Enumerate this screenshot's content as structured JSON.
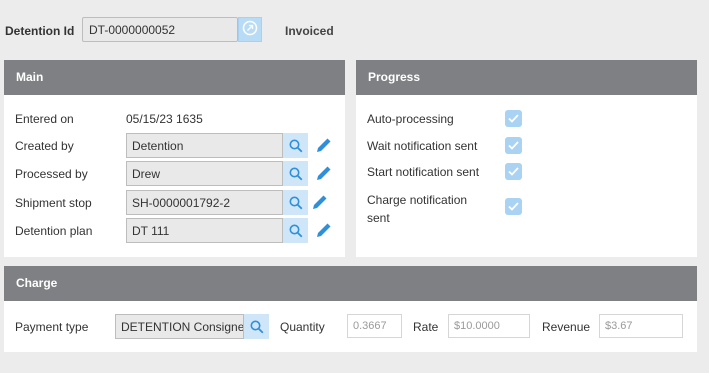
{
  "header": {
    "id_label": "Detention Id",
    "id_value": "DT-0000000052",
    "status": "Invoiced"
  },
  "main": {
    "title": "Main",
    "entered_on_label": "Entered on",
    "entered_on_value": "05/15/23 1635",
    "created_by_label": "Created by",
    "created_by_value": "Detention",
    "processed_by_label": "Processed by",
    "processed_by_value": "Drew",
    "shipment_stop_label": "Shipment stop",
    "shipment_stop_value": "SH-0000001792-2",
    "detention_plan_label": "Detention plan",
    "detention_plan_value": "DT 111"
  },
  "progress": {
    "title": "Progress",
    "items": [
      {
        "label": "Auto-processing",
        "checked": true
      },
      {
        "label": "Wait notification sent",
        "checked": true
      },
      {
        "label": "Start notification sent",
        "checked": true
      },
      {
        "label_line1": "Charge notification",
        "label_line2": "sent",
        "checked": true
      }
    ]
  },
  "charge": {
    "title": "Charge",
    "payment_type_label": "Payment type",
    "payment_type_value": "DETENTION Consignee",
    "quantity_label": "Quantity",
    "quantity_value": "0.3667",
    "rate_label": "Rate",
    "rate_value": "$10.0000",
    "revenue_label": "Revenue",
    "revenue_value": "$3.67"
  },
  "icons": {
    "search": "search-icon",
    "edit": "pencil-icon",
    "check": "check-icon",
    "open": "open-record-icon"
  },
  "colors": {
    "panel_header": "#7e8083",
    "accent_blue": "#2f8fd8",
    "button_blue": "#cfe6f8"
  }
}
